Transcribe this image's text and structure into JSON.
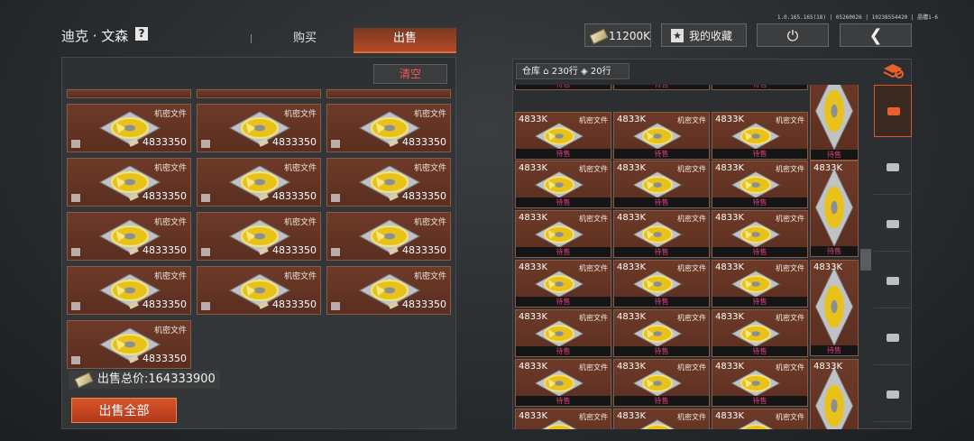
{
  "header": {
    "version": "1.0.165.165(18) | 05260026 | 10238554420 | 晶體1-6",
    "player_name": "迪克 · 文森",
    "help_label": "?",
    "tabs": [
      {
        "label": "购买"
      },
      {
        "label": "出售"
      }
    ],
    "active_tab": "出售",
    "money": "11200K",
    "favorites_label": "我的收藏",
    "power_icon": "power-icon",
    "back_icon": "back-arrow-icon"
  },
  "sell_panel": {
    "clear_label": "清空",
    "item_name": "机密文件",
    "item_price": "4833350",
    "card_count": 13,
    "total_label": "出售总价:164333900",
    "sell_all_label": "出售全部"
  },
  "warehouse": {
    "title": "仓库",
    "capacity": "230行",
    "items_count": "20行",
    "item_name": "机密文件",
    "item_qty": "4833K",
    "status": "待售",
    "categories": [
      "box-stack-icon",
      "storage-icon",
      "helmet-icon",
      "rifle-icon",
      "magazine-icon",
      "ammo-icon",
      "gadget-icon"
    ]
  },
  "colors": {
    "accent": "#d8542a",
    "card": "#6a3626",
    "status_text": "#e0407a"
  }
}
